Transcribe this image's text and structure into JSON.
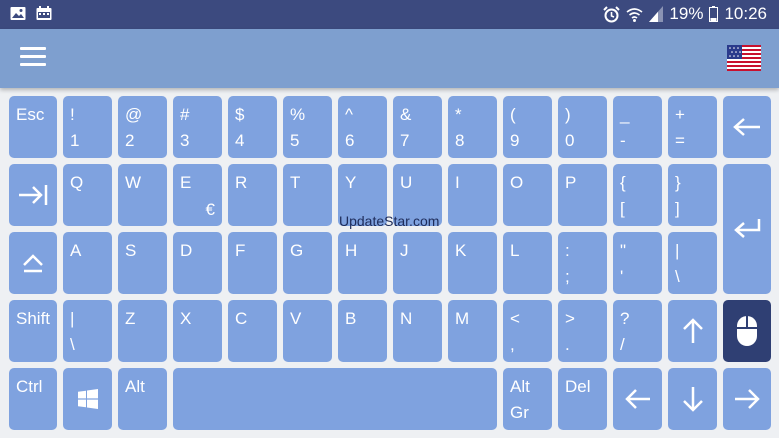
{
  "status_bar": {
    "battery": "19%",
    "time": "10:26",
    "icons": [
      "gallery-icon",
      "calendar-icon",
      "alarm-icon",
      "wifi-icon",
      "signal-icon",
      "battery-icon"
    ]
  },
  "toolbar": {
    "menu_icon": "hamburger-menu-icon",
    "language_flag": "us-flag-icon"
  },
  "watermark": "UpdateStar.com",
  "colors": {
    "status_bar": "#3c4a7f",
    "toolbar": "#7e9fcf",
    "key": "#7fa2df",
    "key_active": "#2f3f73",
    "background": "#eef0f3"
  },
  "keys": {
    "esc": {
      "top": "Esc"
    },
    "n1": {
      "top": "!",
      "bottom": "1"
    },
    "n2": {
      "top": "@",
      "bottom": "2"
    },
    "n3": {
      "top": "#",
      "bottom": "3"
    },
    "n4": {
      "top": "$",
      "bottom": "4"
    },
    "n5": {
      "top": "%",
      "bottom": "5"
    },
    "n6": {
      "top": "^",
      "bottom": "6"
    },
    "n7": {
      "top": "&",
      "bottom": "7"
    },
    "n8": {
      "top": "*",
      "bottom": "8"
    },
    "n9": {
      "top": "(",
      "bottom": "9"
    },
    "n0": {
      "top": ")",
      "bottom": "0"
    },
    "minus": {
      "top": "_",
      "bottom": "-"
    },
    "equals": {
      "top": "+",
      "bottom": "="
    },
    "q": {
      "top": "Q"
    },
    "w": {
      "top": "W"
    },
    "e": {
      "top": "E",
      "alt": "€"
    },
    "r": {
      "top": "R"
    },
    "t": {
      "top": "T"
    },
    "y": {
      "top": "Y"
    },
    "u": {
      "top": "U"
    },
    "i": {
      "top": "I"
    },
    "o": {
      "top": "O"
    },
    "p": {
      "top": "P"
    },
    "lbracket": {
      "top": "{",
      "bottom": "["
    },
    "rbracket": {
      "top": "}",
      "bottom": "]"
    },
    "a": {
      "top": "A"
    },
    "s": {
      "top": "S"
    },
    "d": {
      "top": "D"
    },
    "f": {
      "top": "F"
    },
    "g": {
      "top": "G"
    },
    "h": {
      "top": "H"
    },
    "j": {
      "top": "J"
    },
    "k": {
      "top": "K"
    },
    "l": {
      "top": "L"
    },
    "semicolon": {
      "top": ":",
      "bottom": ";"
    },
    "quote": {
      "top": "\"",
      "bottom": "'"
    },
    "backslash": {
      "top": "|",
      "bottom": "\\"
    },
    "shift": {
      "top": "Shift"
    },
    "pipe2": {
      "top": "|",
      "bottom": "\\"
    },
    "z": {
      "top": "Z"
    },
    "x": {
      "top": "X"
    },
    "c": {
      "top": "C"
    },
    "v": {
      "top": "V"
    },
    "b": {
      "top": "B"
    },
    "n": {
      "top": "N"
    },
    "m": {
      "top": "M"
    },
    "comma": {
      "top": "<",
      "bottom": ","
    },
    "period": {
      "top": ">",
      "bottom": "."
    },
    "slash": {
      "top": "?",
      "bottom": "/"
    },
    "ctrl": {
      "top": "Ctrl"
    },
    "alt": {
      "top": "Alt"
    },
    "altgr": {
      "top": "Alt",
      "bottom": "Gr"
    },
    "del": {
      "top": "Del"
    }
  },
  "icon_keys": {
    "backspace": "backspace-arrow-icon",
    "tab": "tab-arrow-icon",
    "enter": "enter-return-icon",
    "caps": "caps-lock-icon",
    "up": "arrow-up-icon",
    "mouse": "mouse-icon",
    "windows": "windows-logo-icon",
    "left": "arrow-left-icon",
    "down": "arrow-down-icon",
    "right": "arrow-right-icon"
  }
}
